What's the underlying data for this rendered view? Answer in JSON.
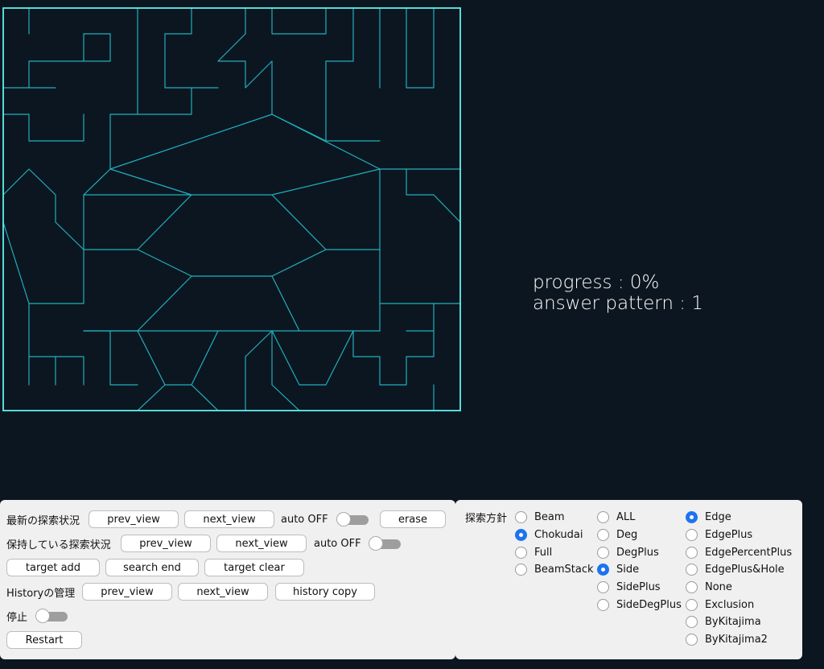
{
  "canvas": {
    "line_color": "#1fb0bd",
    "frame_color": "#5ff0ee",
    "background": "#0c1620"
  },
  "status": {
    "progress": "progress : 0%",
    "answer_pattern": "answer pattern : 1"
  },
  "controls": {
    "latest_search_label": "最新の探索状況",
    "saved_search_label": "保持している探索状況",
    "history_label": "Historyの管理",
    "stop_label": "停止",
    "prev_view": "prev_view",
    "next_view": "next_view",
    "auto_off": "auto OFF",
    "erase": "erase",
    "target_add": "target add",
    "search_end": "search end",
    "target_clear": "target clear",
    "history_copy": "history copy",
    "restart": "Restart"
  },
  "strategy": {
    "heading": "探索方針",
    "col1": [
      {
        "label": "Beam",
        "selected": false
      },
      {
        "label": "Chokudai",
        "selected": true
      },
      {
        "label": "Full",
        "selected": false
      },
      {
        "label": "BeamStack",
        "selected": false
      }
    ],
    "col2": [
      {
        "label": "ALL",
        "selected": false
      },
      {
        "label": "Deg",
        "selected": false
      },
      {
        "label": "DegPlus",
        "selected": false
      },
      {
        "label": "Side",
        "selected": true
      },
      {
        "label": "SidePlus",
        "selected": false
      },
      {
        "label": "SideDegPlus",
        "selected": false
      }
    ],
    "col3": [
      {
        "label": "Edge",
        "selected": true
      },
      {
        "label": "EdgePlus",
        "selected": false
      },
      {
        "label": "EdgePercentPlus",
        "selected": false
      },
      {
        "label": "EdgePlus&Hole",
        "selected": false
      },
      {
        "label": "None",
        "selected": false
      },
      {
        "label": "Exclusion",
        "selected": false
      },
      {
        "label": "ByKitajima",
        "selected": false
      },
      {
        "label": "ByKitajima2",
        "selected": false
      }
    ]
  }
}
